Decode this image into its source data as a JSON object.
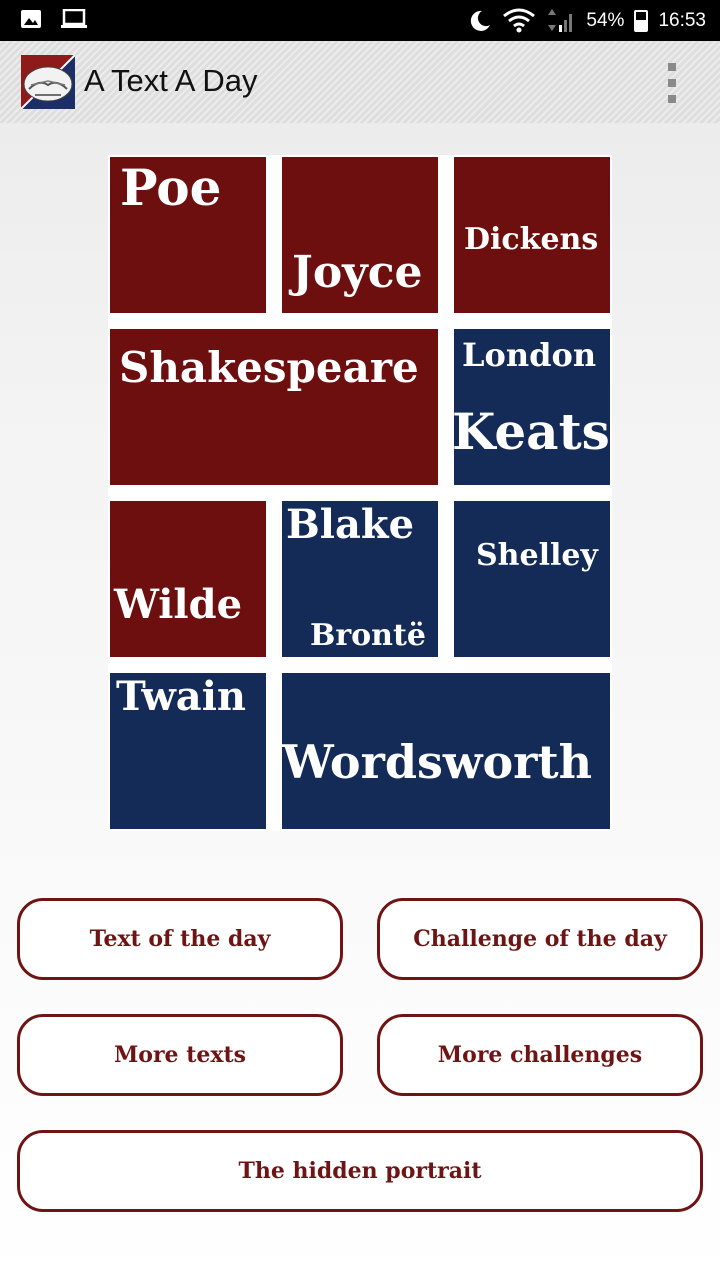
{
  "status_bar": {
    "left_icons": [
      "image-icon",
      "laptop-icon"
    ],
    "right_icons": [
      "moon-icon",
      "wifi-icon",
      "signal-icon"
    ],
    "battery_level_percent": 54,
    "battery_text": "54%",
    "time": "16:53"
  },
  "app_bar": {
    "title": "A Text A Day",
    "logo_icon": "book-logo-icon",
    "menu_icon": "overflow-menu-icon"
  },
  "collage": {
    "colors": {
      "red": "#6e0f0f",
      "blue": "#142b58"
    },
    "tiles": [
      {
        "labels": [
          "Poe"
        ],
        "color": "red"
      },
      {
        "labels": [
          "Joyce"
        ],
        "color": "red"
      },
      {
        "labels": [
          "Dickens"
        ],
        "color": "red"
      },
      {
        "labels": [
          "Shakespeare"
        ],
        "color": "red"
      },
      {
        "labels": [
          "London",
          "Keats"
        ],
        "color": "blue"
      },
      {
        "labels": [
          "Wilde"
        ],
        "color": "red"
      },
      {
        "labels": [
          "Blake",
          "Brontë"
        ],
        "color": "blue"
      },
      {
        "labels": [
          "Shelley"
        ],
        "color": "blue"
      },
      {
        "labels": [
          "Twain"
        ],
        "color": "blue"
      },
      {
        "labels": [
          "Wordsworth"
        ],
        "color": "blue"
      }
    ]
  },
  "buttons": {
    "text_of_the_day": "Text of the day",
    "challenge_of_the_day": "Challenge of the day",
    "more_texts": "More texts",
    "more_challenges": "More challenges",
    "hidden_portrait": "The hidden portrait"
  },
  "accent_color": "#6f1414"
}
